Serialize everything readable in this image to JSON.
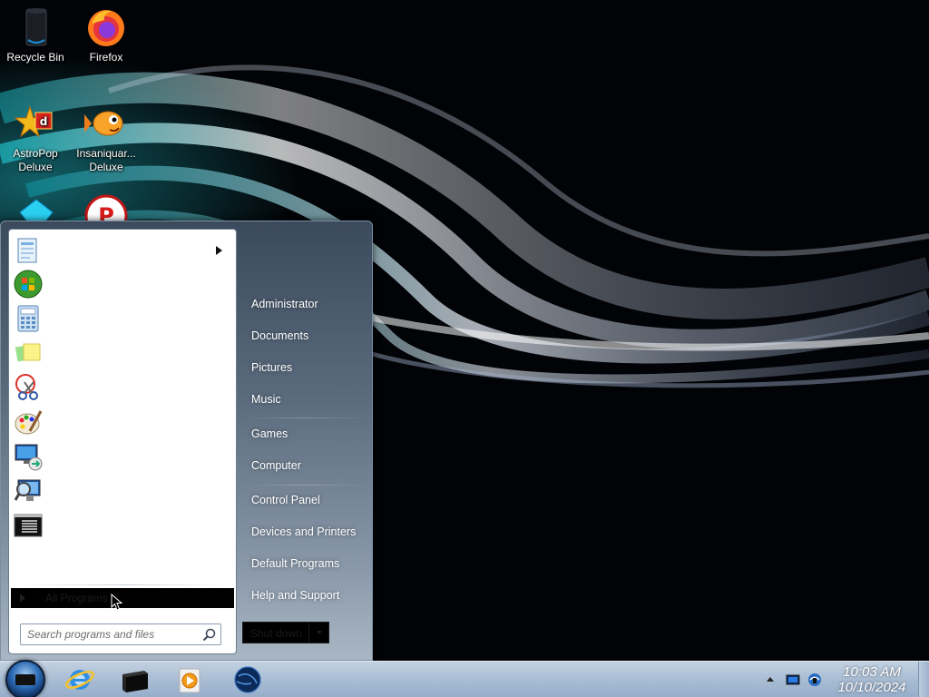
{
  "desktop": {
    "icons": [
      {
        "label": "Recycle Bin",
        "icon": "recycle-bin-icon"
      },
      {
        "label": "Firefox",
        "icon": "firefox-icon"
      },
      {
        "label": "AstroPop Deluxe",
        "icon": "astropop-icon"
      },
      {
        "label": "Insaniquar... Deluxe",
        "icon": "insaniquarium-icon"
      }
    ]
  },
  "start_menu": {
    "pinned_programs": [
      {
        "icon": "getting-started-icon",
        "has_submenu": true
      },
      {
        "icon": "windows-media-center-icon"
      },
      {
        "icon": "calculator-icon"
      },
      {
        "icon": "sticky-notes-icon"
      },
      {
        "icon": "snipping-tool-icon"
      },
      {
        "icon": "paint-icon"
      },
      {
        "icon": "remote-desktop-icon"
      },
      {
        "icon": "magnifier-icon"
      },
      {
        "icon": "command-prompt-icon"
      }
    ],
    "all_programs_label": "All Programs",
    "search_placeholder": "Search programs and files",
    "right_items": [
      "Administrator",
      "Documents",
      "Pictures",
      "Music",
      "Games",
      "Computer",
      "Control Panel",
      "Devices and Printers",
      "Default Programs",
      "Help and Support"
    ],
    "shutdown_label": "Shut down"
  },
  "taskbar": {
    "pinned": [
      "internet-explorer-icon",
      "command-prompt-icon",
      "windows-media-player-icon",
      "network-globe-icon"
    ],
    "tray_icons": [
      "show-hidden-icons",
      "action-center-icon",
      "network-icon"
    ],
    "time": "10:03 AM",
    "date": "10/10/2024"
  },
  "colors": {
    "taskbar": "#a9bdd3",
    "start_menu_frame": "#5a6b7d",
    "highlight": "#000000"
  }
}
